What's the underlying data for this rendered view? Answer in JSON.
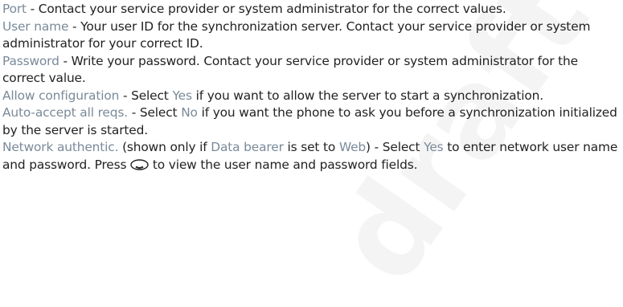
{
  "watermark": "draft",
  "paragraphs": [
    {
      "term": "Port",
      "text": " - Contact your service provider or system administrator for the correct values."
    },
    {
      "term": "User name",
      "text": " - Your user ID for the synchronization server. Contact your service provider or system administrator for your correct ID."
    },
    {
      "term": "Password",
      "text": " - Write your password. Contact your service provider or system administrator for the correct value."
    },
    {
      "term": "Allow configuration",
      "text_a": " - Select ",
      "value": "Yes",
      "text_b": " if you want to allow the server to start a synchronization."
    },
    {
      "term": "Auto-accept all reqs.",
      "text_a": " - Select ",
      "value": "No",
      "text_b": " if you want the phone to ask you before a synchronization initialized by the server is started."
    },
    {
      "term": "Network authentic.",
      "text_a": " (shown only if ",
      "setting": "Data bearer",
      "text_b": " is set to ",
      "setting_value": "Web",
      "text_c": ") - Select ",
      "value": "Yes",
      "text_d": " to enter network user name and password. Press ",
      "text_e": " to view the user name and password fields."
    }
  ],
  "icons": {
    "scroll_key": "scroll-key-icon"
  }
}
